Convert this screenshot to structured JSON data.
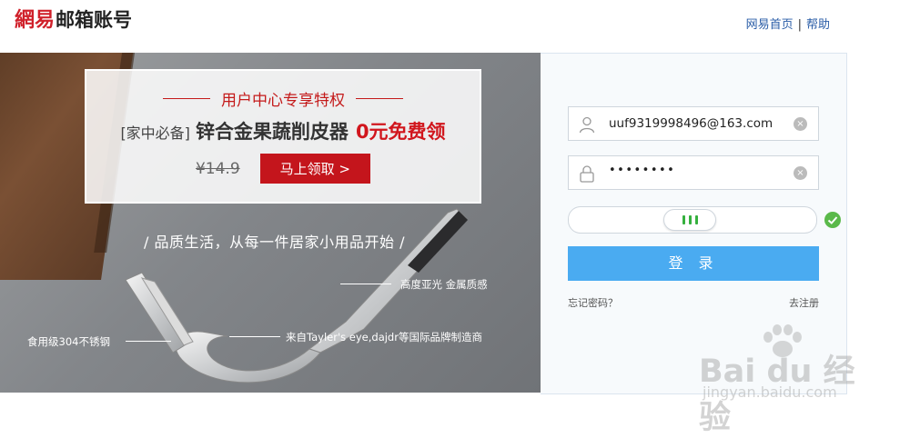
{
  "header": {
    "brand": "網易",
    "title": "邮箱账号",
    "links": [
      {
        "label": "网易首页"
      },
      {
        "label": "帮助"
      }
    ],
    "separator": "|"
  },
  "banner": {
    "promo_heading": "用户中心专享特权",
    "product_tag": "[家中必备]",
    "product_name": "锌合金果蔬削皮器",
    "product_offer": "0元免费领",
    "old_price": "¥14.9",
    "claim_button": "马上领取 >",
    "slogan": "/ 品质生活，从每一件居家小用品开始 /",
    "features": [
      {
        "text": "高度亚光 金属质感"
      },
      {
        "text": "食用级304不锈钢"
      },
      {
        "text": "来自Tayler's eye,dajdr等国际品牌制造商"
      }
    ]
  },
  "login": {
    "username_value": "uuf9319998496@163.com",
    "password_value": "••••••••",
    "clear_symbol": "×",
    "slider_verified": true,
    "login_button": "登 录",
    "forgot_password": "忘记密码？",
    "register": "去注册"
  },
  "watermark": {
    "text": "Bai du 经验",
    "url": "jingyan.baidu.com"
  },
  "colors": {
    "brand_red": "#d0212b",
    "link_blue": "#2a5da7",
    "login_blue": "#4aabf1",
    "verified_green": "#5ab94a",
    "promo_red": "#c4151c"
  }
}
